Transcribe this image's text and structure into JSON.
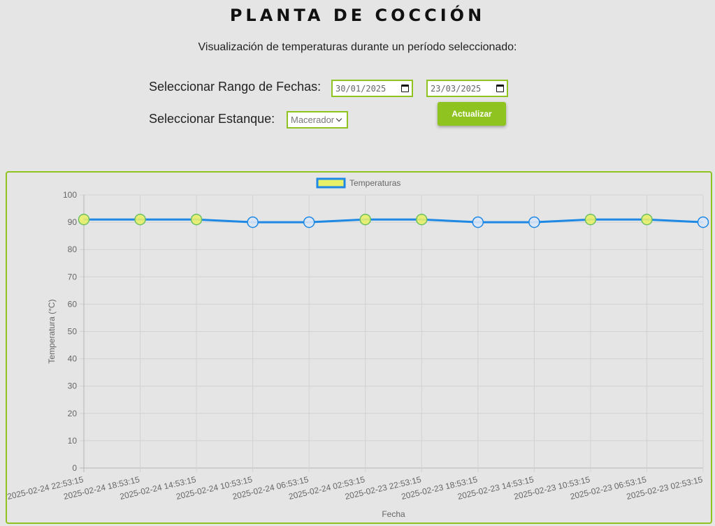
{
  "header": {
    "title": "PLANTA DE COCCIÓN",
    "subtitle": "Visualización de temperaturas durante un período seleccionado:"
  },
  "form": {
    "date_range_label": "Seleccionar Rango de Fechas:",
    "start_date": "30/01/2025",
    "end_date": "23/03/2025",
    "tank_label": "Seleccionar Estanque:",
    "tank_selected": "Macerador",
    "update_button": "Actualizar"
  },
  "colors": {
    "accent": "#8fc31f",
    "line": "#1e88e5",
    "point_fill": "#e8f06a"
  },
  "chart_data": {
    "type": "line",
    "xlabel": "Fecha",
    "ylabel": "Temperatura (°C)",
    "ylim": [
      0,
      100
    ],
    "yticks": [
      0,
      10,
      20,
      30,
      40,
      50,
      60,
      70,
      80,
      90,
      100
    ],
    "legend_position": "top-center",
    "grid": true,
    "categories": [
      "2025-02-24 22:53:15",
      "2025-02-24 18:53:15",
      "2025-02-24 14:53:15",
      "2025-02-24 10:53:15",
      "2025-02-24 06:53:15",
      "2025-02-24 02:53:15",
      "2025-02-23 22:53:15",
      "2025-02-23 18:53:15",
      "2025-02-23 14:53:15",
      "2025-02-23 10:53:15",
      "2025-02-23 06:53:15",
      "2025-02-23 02:53:15"
    ],
    "series": [
      {
        "name": "Temperaturas",
        "values": [
          91,
          91,
          91,
          90,
          90,
          91,
          91,
          90,
          90,
          91,
          91,
          90
        ]
      }
    ]
  }
}
